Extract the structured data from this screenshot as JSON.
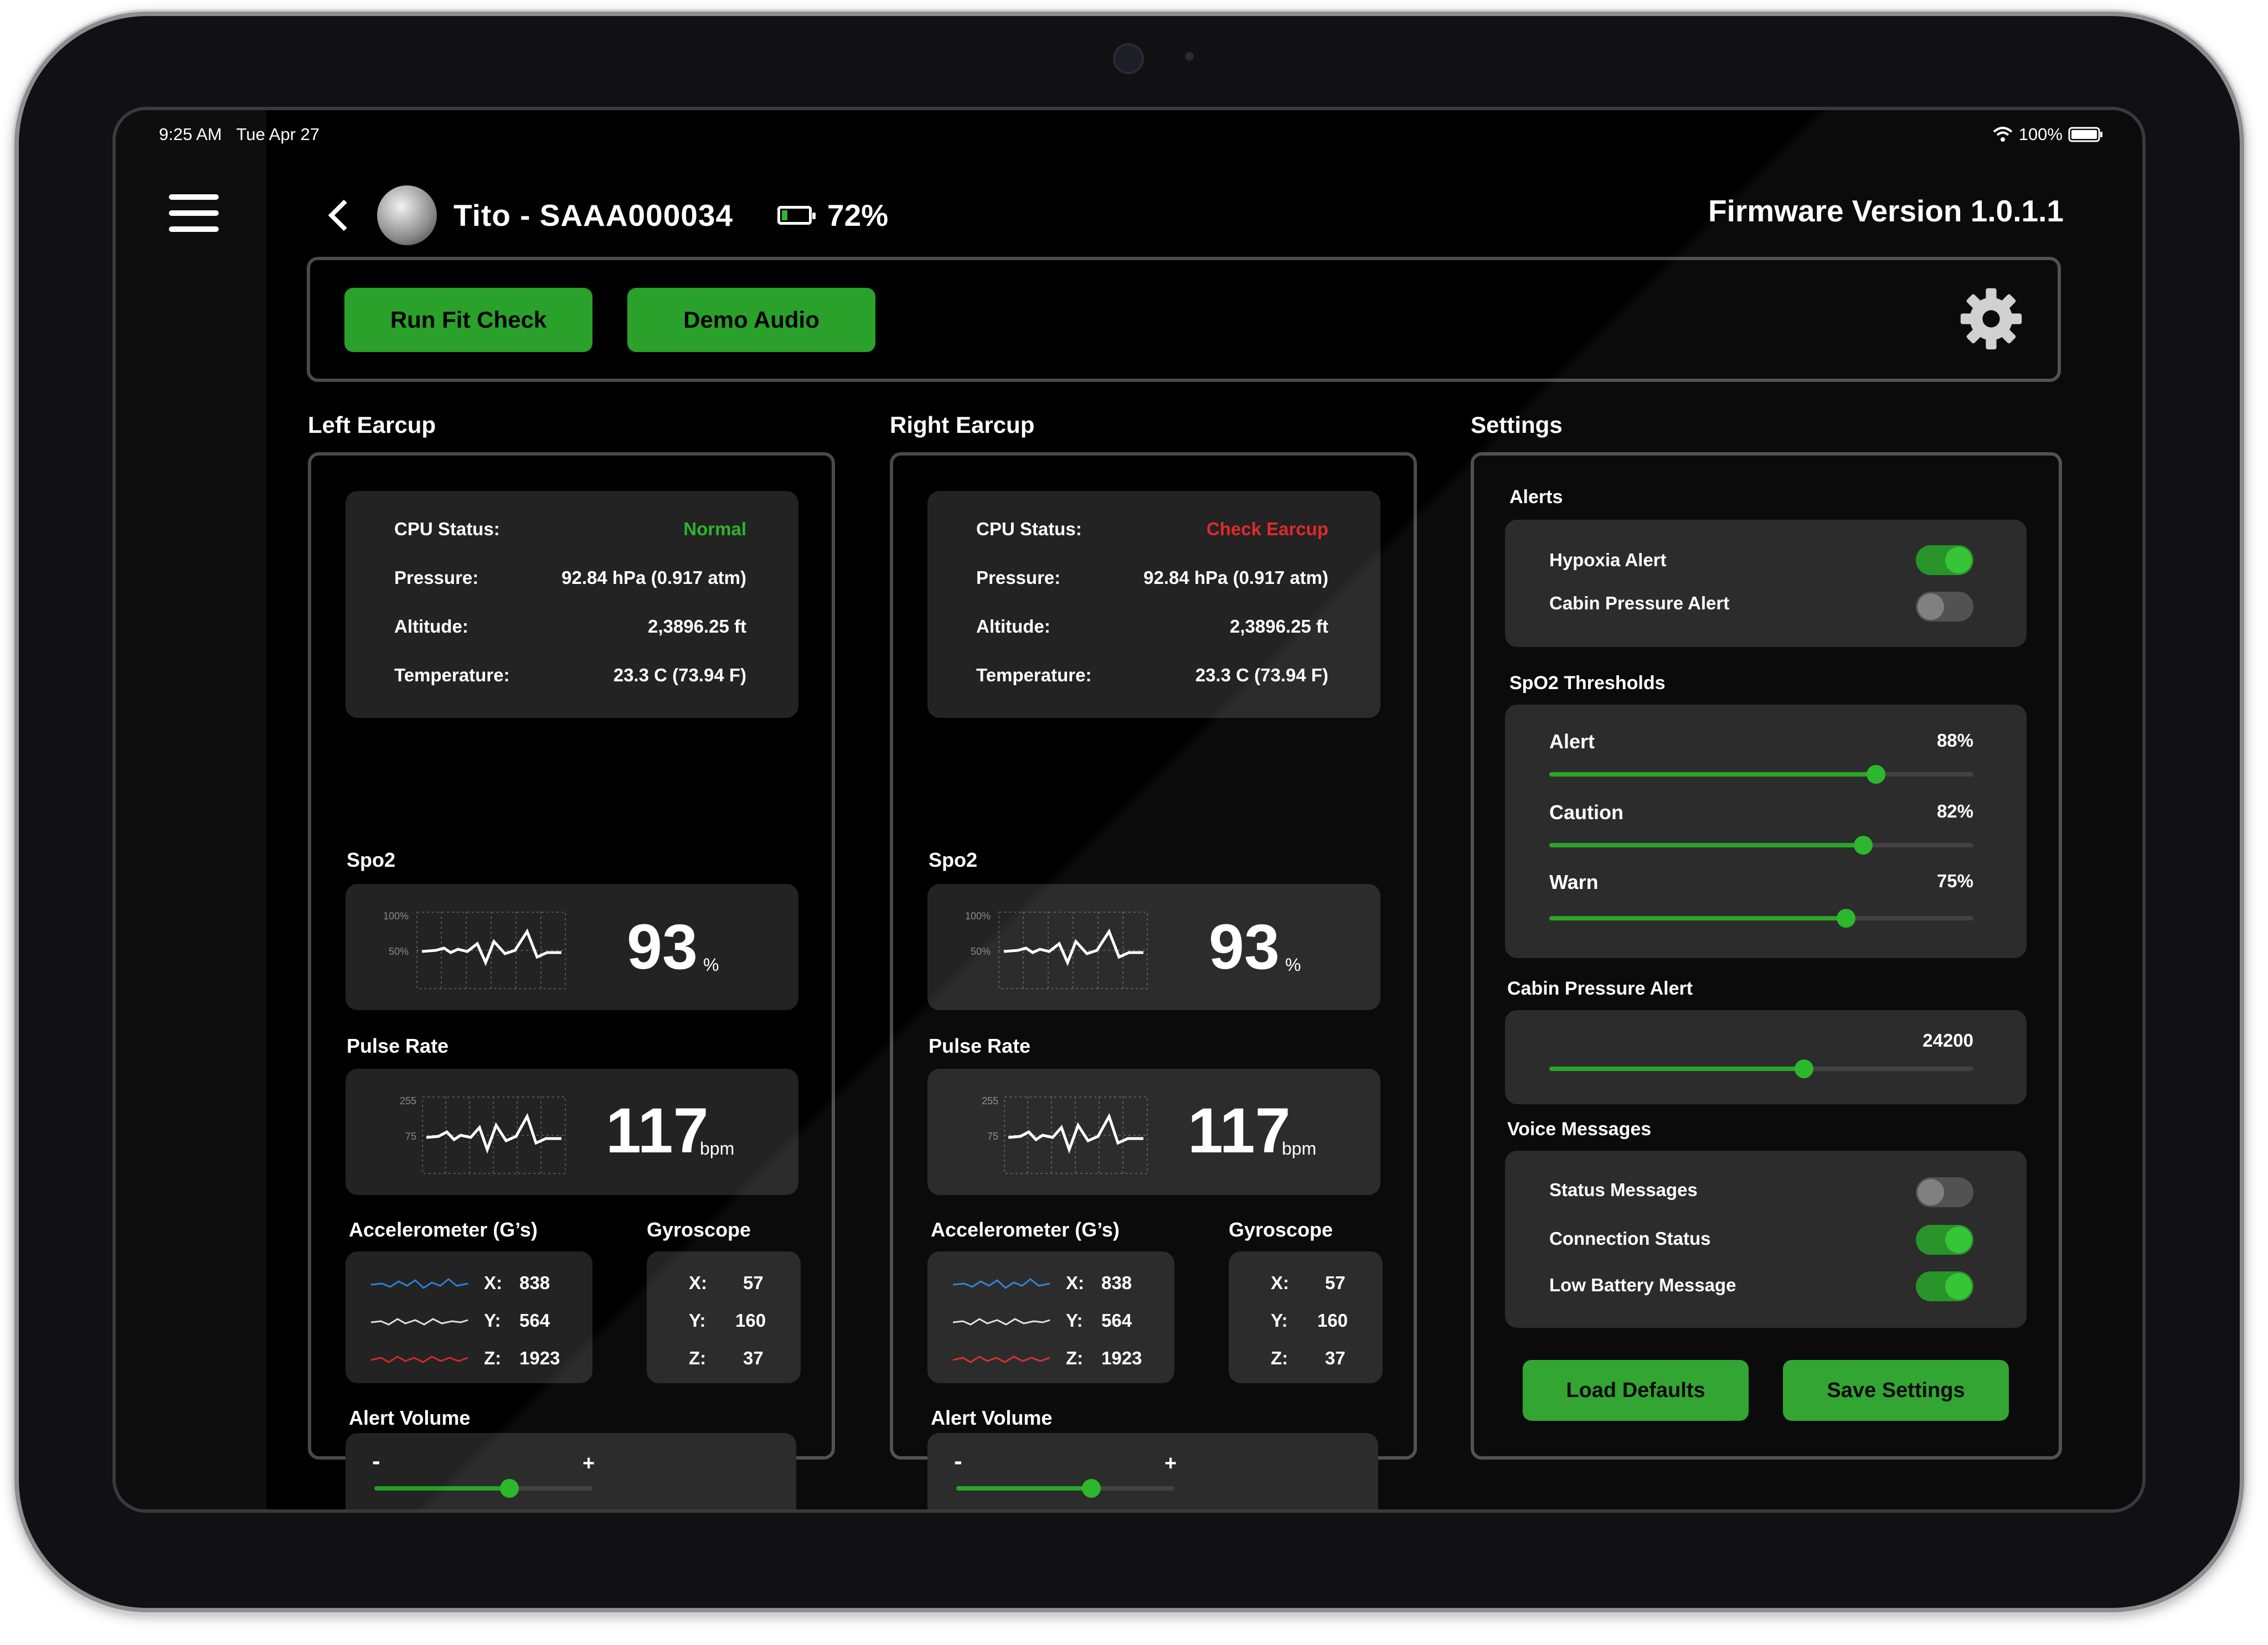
{
  "status_bar": {
    "time": "9:25 AM",
    "date": "Tue Apr 27",
    "battery": "100%"
  },
  "header": {
    "device_name": "Tito - SAAA000034",
    "battery_percent": "72%",
    "firmware": "Firmware Version 1.0.1.1"
  },
  "toolbar": {
    "run_fit_check": "Run Fit Check",
    "demo_audio": "Demo Audio"
  },
  "left": {
    "title": "Left Earcup",
    "cpu_label": "CPU Status:",
    "cpu_value": "Normal",
    "cpu_color": "#2db52d",
    "pressure_label": "Pressure:",
    "pressure_value": "92.84 hPa (0.917 atm)",
    "altitude_label": "Altitude:",
    "altitude_value": "2,3896.25 ft",
    "temp_label": "Temperature:",
    "temp_value": "23.3 C (73.94 F)",
    "spo2_title": "Spo2",
    "spo2_value": "93",
    "spo2_unit": "%",
    "spo2_tick_high": "100%",
    "spo2_tick_low": "50%",
    "pulse_title": "Pulse Rate",
    "pulse_value": "117",
    "pulse_unit": "bpm",
    "pulse_tick_high": "255",
    "pulse_tick_low": "75",
    "accel_title": "Accelerometer (G’s)",
    "gyro_title": "Gyroscope",
    "accel": {
      "x_label": "X:",
      "x": "838",
      "y_label": "Y:",
      "y": "564",
      "z_label": "Z:",
      "z": "1923"
    },
    "gyro": {
      "x_label": "X:",
      "x": "57",
      "y_label": "Y:",
      "y": "160",
      "z_label": "Z:",
      "z": "37"
    },
    "volume_title": "Alert Volume",
    "volume_minus": "-",
    "volume_plus": "+",
    "volume_level": 0.62
  },
  "right": {
    "title": "Right Earcup",
    "cpu_label": "CPU Status:",
    "cpu_value": "Check Earcup",
    "cpu_color": "#e02a2a",
    "pressure_label": "Pressure:",
    "pressure_value": "92.84 hPa (0.917 atm)",
    "altitude_label": "Altitude:",
    "altitude_value": "2,3896.25 ft",
    "temp_label": "Temperature:",
    "temp_value": "23.3 C (73.94 F)",
    "spo2_title": "Spo2",
    "spo2_value": "93",
    "spo2_unit": "%",
    "spo2_tick_high": "100%",
    "spo2_tick_low": "50%",
    "pulse_title": "Pulse Rate",
    "pulse_value": "117",
    "pulse_unit": "bpm",
    "pulse_tick_high": "255",
    "pulse_tick_low": "75",
    "accel_title": "Accelerometer (G’s)",
    "gyro_title": "Gyroscope",
    "accel": {
      "x_label": "X:",
      "x": "838",
      "y_label": "Y:",
      "y": "564",
      "z_label": "Z:",
      "z": "1923"
    },
    "gyro": {
      "x_label": "X:",
      "x": "57",
      "y_label": "Y:",
      "y": "160",
      "z_label": "Z:",
      "z": "37"
    },
    "volume_title": "Alert Volume",
    "volume_minus": "-",
    "volume_plus": "+",
    "volume_level": 0.62
  },
  "settings": {
    "title": "Settings",
    "alerts_title": "Alerts",
    "hypoxia_label": "Hypoxia Alert",
    "hypoxia_on": true,
    "cabin_alert_label": "Cabin Pressure Alert",
    "cabin_alert_on": false,
    "spo2_title": "SpO2 Thresholds",
    "alert_label": "Alert",
    "alert_value": "88%",
    "alert_level": 0.77,
    "caution_label": "Caution",
    "caution_value": "82%",
    "caution_level": 0.74,
    "warn_label": "Warn",
    "warn_value": "75%",
    "warn_level": 0.7,
    "cabin_title": "Cabin Pressure Alert",
    "cabin_value": "24200",
    "cabin_level": 0.6,
    "voice_title": "Voice Messages",
    "status_msg_label": "Status Messages",
    "status_msg_on": false,
    "connection_label": "Connection Status",
    "connection_on": true,
    "low_batt_label": "Low Battery Message",
    "low_batt_on": true,
    "load_defaults": "Load Defaults",
    "save_settings": "Save Settings"
  },
  "colors": {
    "accent": "#2aa12a",
    "panel": "#232323",
    "background": "#000000"
  }
}
